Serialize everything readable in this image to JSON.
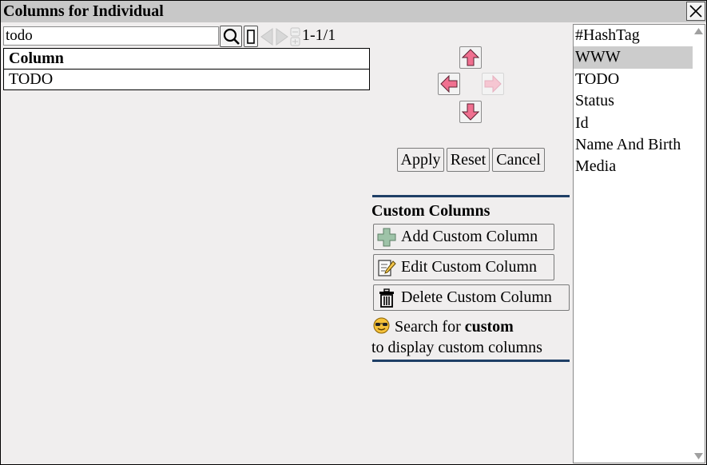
{
  "dialog": {
    "title": "Columns for Individual",
    "close_icon": "close-icon"
  },
  "search": {
    "value": "todo",
    "search_icon": "magnifier-icon",
    "clear_icon": "clear-box-icon",
    "result_count": "1-1/1"
  },
  "table": {
    "header": "Column",
    "rows": [
      "TODO"
    ]
  },
  "arrows": {
    "up_icon": "arrow-up-icon",
    "left_icon": "arrow-left-icon",
    "right_icon": "arrow-right-icon",
    "down_icon": "arrow-down-icon",
    "color": "#f07090"
  },
  "actions": {
    "apply": "Apply",
    "reset": "Reset",
    "cancel": "Cancel"
  },
  "custom": {
    "heading": "Custom Columns",
    "add": "Add Custom Column",
    "edit": "Edit Custom Column",
    "delete": "Delete Custom Column",
    "hint_prefix": "Search for",
    "hint_bold": "custom",
    "hint_line2": "to display custom columns",
    "separator_color": "#1f3f66"
  },
  "columns_list": {
    "items": [
      "#HashTag",
      "WWW",
      "TODO",
      "Status",
      "Id",
      "Name And Birth",
      "Media"
    ],
    "selected": "WWW"
  }
}
